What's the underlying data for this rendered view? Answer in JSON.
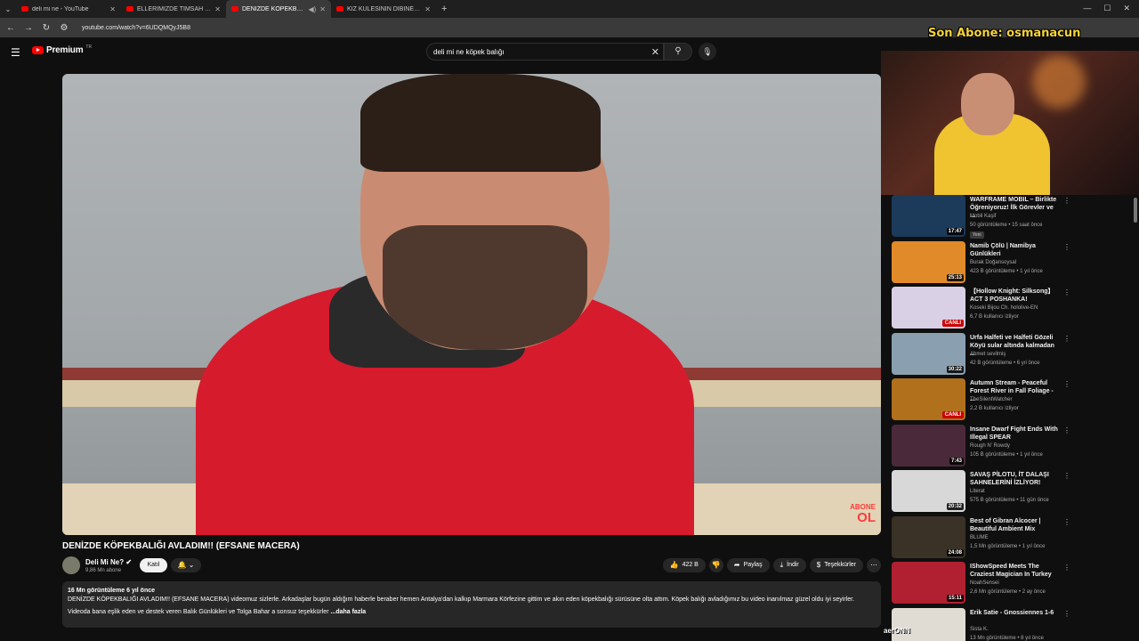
{
  "browser": {
    "tabs": [
      {
        "title": "deli mi ne - YouTube",
        "active": false
      },
      {
        "title": "ELLERİMİZDE TİMSAH TUTTUK",
        "active": false
      },
      {
        "title": "DENİZDE KÖPEKBALIĞI AV",
        "active": true
      },
      {
        "title": "KIZ KULESİNİN DİBİNE DALDIM",
        "active": false
      }
    ],
    "new_tab": "+",
    "url": "youtube.com/watch?v=6UDQMQyJ5B8"
  },
  "stream_overlay": {
    "sub_text": "Son Abone: osmanacun",
    "bottom_name": "aerONN"
  },
  "header": {
    "logo_word": "Premium",
    "logo_region": "TR",
    "search_value": "deli mi ne köpek balığı"
  },
  "video": {
    "title": "DENİZDE KÖPEKBALIĞI AVLADIM!! (EFSANE MACERA)",
    "watermark_small": "ABONE",
    "watermark_big": "OL",
    "channel": {
      "name": "Deli Mi Ne?",
      "subs": "9,86 Mn abone"
    },
    "join_label": "Katıl",
    "likes": "422 B",
    "share_label": "Paylaş",
    "download_label": "İndir",
    "thanks_label": "Teşekkürler",
    "description": {
      "meta": "16 Mn görüntüleme  6 yıl önce",
      "line1": "DENİZDE KÖPEKBALIĞI AVLADIM!! (EFSANE MACERA) videomuz sizlerle. Arkadaşlar bugün aldığım haberle beraber hemen Antalya'dan kalkıp Marmara Körfezine gittim ve akın eden köpekbalığı sürüsüne olta attım. Köpek balığı avladığımız bu video inanılmaz güzel oldu iyi seyirler.",
      "line2": "Videoda bana eşlik eden ve destek veren Balık Günlükleri ve Tolga Bahar a sonsuz teşekkürler",
      "more": "...daha fazla"
    }
  },
  "recommendations": [
    {
      "title": "WARFRAME MOBIL – Birlikte Öğreniyoruz! İlk Görevler ve ...",
      "channel": "Mobil Kaşif",
      "meta": "50 görüntüleme • 15 saat önce",
      "badge": "Yeni",
      "duration": "17:47",
      "live": false,
      "thumb_color": "#1c3a5a"
    },
    {
      "title": "Namib Çölü | Namibya Günlükleri",
      "channel": "Burak Doğansoysal",
      "meta": "423 B görüntüleme • 1 yıl önce",
      "badge": "",
      "duration": "25:13",
      "live": false,
      "thumb_color": "#e08a2a"
    },
    {
      "title": "【Hollow Knight: Silksong】 ACT 3 POSHANKA!",
      "channel": "Koseki Bijou Ch. hololive-EN",
      "meta": "6,7 B kullanıcı izliyor",
      "badge": "",
      "duration": "CANLI",
      "live": true,
      "thumb_color": "#d9d0e6"
    },
    {
      "title": "Urfa Halfeti ve Halfeti Gözeli Köyü sular altında kalmadan ...",
      "channel": "Ahmet sevilmiş",
      "meta": "42 B görüntüleme • 6 yıl önce",
      "badge": "",
      "duration": "30:22",
      "live": false,
      "thumb_color": "#8aa0b0"
    },
    {
      "title": "Autumn Stream - Peaceful Forest River in Fall Foliage - ...",
      "channel": "TheSilentWatcher",
      "meta": "2,2 B kullanıcı izliyor",
      "badge": "",
      "duration": "CANLI",
      "live": true,
      "thumb_color": "#b0701c"
    },
    {
      "title": "Insane Dwarf Fight Ends With Illegal SPEAR",
      "channel": "Rough N' Rowdy",
      "meta": "105 B görüntüleme • 1 yıl önce",
      "badge": "",
      "duration": "7:43",
      "live": false,
      "thumb_color": "#4a2a3a"
    },
    {
      "title": "SAVAŞ PİLOTU, İT DALAŞI SAHNELERİNİ İZLİYOR!",
      "channel": "Literat",
      "meta": "575 B görüntüleme • 11 gün önce",
      "badge": "",
      "duration": "20:32",
      "live": false,
      "thumb_color": "#d8d8d8"
    },
    {
      "title": "Best of Gibran Alcocer | Beautiful Ambient Mix",
      "channel": "BLUME",
      "meta": "1,5 Mn görüntüleme • 1 yıl önce",
      "badge": "",
      "duration": "24:08",
      "live": false,
      "thumb_color": "#3a3226"
    },
    {
      "title": "IShowSpeed Meets The Craziest Magician In Turkey",
      "channel": "NoahSensei",
      "meta": "2,6 Mn görüntüleme • 2 ay önce",
      "badge": "",
      "duration": "15:11",
      "live": false,
      "thumb_color": "#b02030"
    },
    {
      "title": "Erik Satie - Gnossiennes 1-6",
      "channel": "Sista K.",
      "meta": "13 Mn görüntüleme • 8 yıl önce",
      "badge": "",
      "duration": "",
      "live": false,
      "thumb_color": "#e0dcd4"
    }
  ]
}
